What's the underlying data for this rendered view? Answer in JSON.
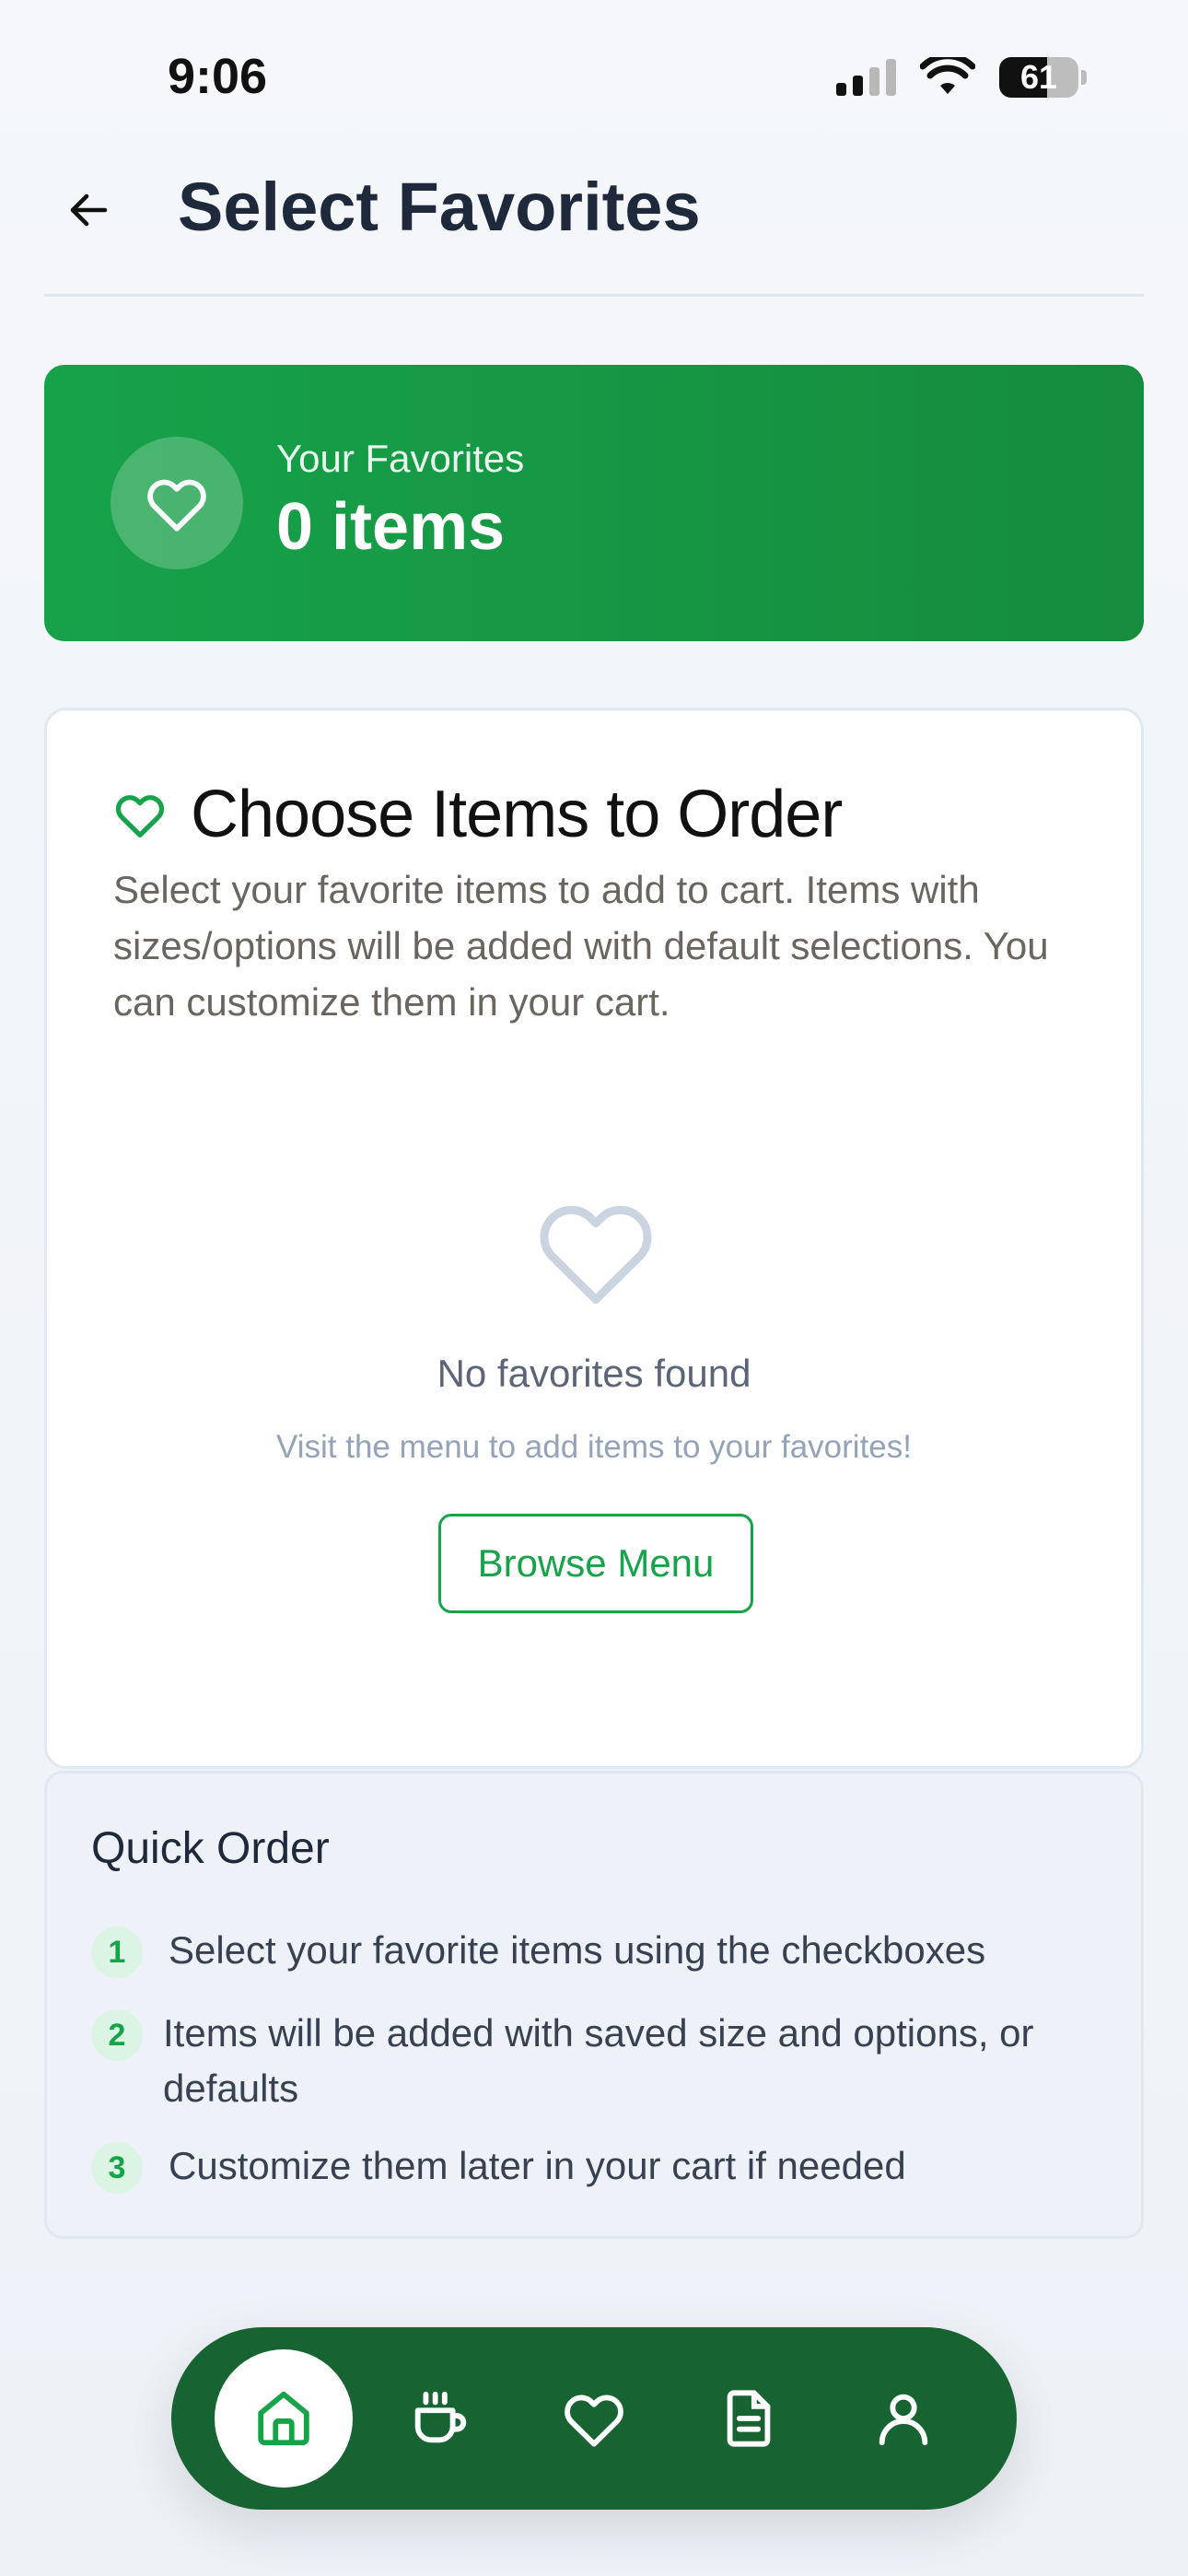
{
  "status_bar": {
    "time": "9:06",
    "battery_level": "61",
    "signal_bars_filled": 2,
    "signal_bars_total": 4
  },
  "header": {
    "title": "Select Favorites",
    "back_icon": "arrow-left-icon"
  },
  "favorites_banner": {
    "label": "Your Favorites",
    "count": "0 items",
    "icon": "heart-icon",
    "colors": {
      "start": "#17a24a",
      "end": "#158c3e"
    }
  },
  "choose_card": {
    "title": "Choose Items to Order",
    "description": "Select your favorite items to add to cart. Items with sizes/options will be added with default selections. You can customize them in your cart.",
    "empty_state": {
      "icon": "heart-outline-icon",
      "title": "No favorites found",
      "subtitle": "Visit the menu to add items to your favorites!",
      "button_label": "Browse Menu"
    }
  },
  "quick_order": {
    "title": "Quick Order",
    "steps": [
      {
        "number": "1",
        "text": "Select your favorite items using the checkboxes"
      },
      {
        "number": "2",
        "text": "Items will be added with saved size and options, or defaults"
      },
      {
        "number": "3",
        "text": "Customize them later in your cart if needed"
      }
    ]
  },
  "bottom_nav": {
    "active": "home",
    "items": [
      {
        "id": "home",
        "icon": "home-icon"
      },
      {
        "id": "menu",
        "icon": "coffee-cup-icon"
      },
      {
        "id": "favorites",
        "icon": "heart-icon"
      },
      {
        "id": "orders",
        "icon": "document-icon"
      },
      {
        "id": "profile",
        "icon": "user-icon"
      }
    ],
    "colors": {
      "background": "#176432",
      "active_icon": "#16a34a",
      "icon": "#ffffff"
    }
  },
  "theme": {
    "accent": "#16a34a",
    "text_primary": "#1e293b",
    "text_muted": "#6b6560"
  }
}
